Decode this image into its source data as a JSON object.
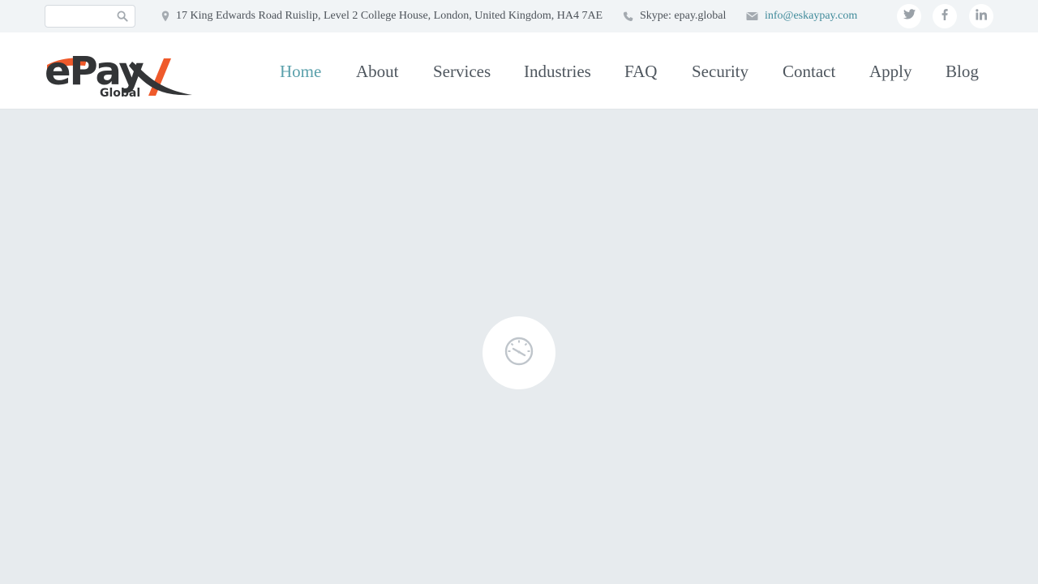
{
  "topbar": {
    "search": {
      "value": "",
      "placeholder": ""
    },
    "address": "17 King Edwards Road Ruislip, Level 2 College House, London, United Kingdom, HA4 7AE",
    "skype": "Skype: epay.global",
    "email": "info@eskaypay.com",
    "icons": {
      "search": "search-icon",
      "address": "map-marker-icon",
      "skype": "phone-icon",
      "email": "envelope-icon"
    },
    "social": [
      "twitter-icon",
      "facebook-icon",
      "linkedin-icon"
    ]
  },
  "header": {
    "logo": {
      "main_text": "ePay",
      "sub_text": "Global"
    },
    "nav": [
      {
        "label": "Home",
        "active": true
      },
      {
        "label": "About"
      },
      {
        "label": "Services"
      },
      {
        "label": "Industries"
      },
      {
        "label": "FAQ"
      },
      {
        "label": "Security"
      },
      {
        "label": "Contact"
      },
      {
        "label": "Apply"
      },
      {
        "label": "Blog"
      }
    ]
  },
  "content": {
    "loader_icon": "gauge-icon"
  },
  "colors": {
    "accent": "#5aa0ab",
    "link": "#3f8a9a",
    "logo_orange": "#ef5a2b",
    "logo_dark": "#333537",
    "page_bg": "#e7ebee",
    "topbar_bg": "#f1f4f6"
  }
}
